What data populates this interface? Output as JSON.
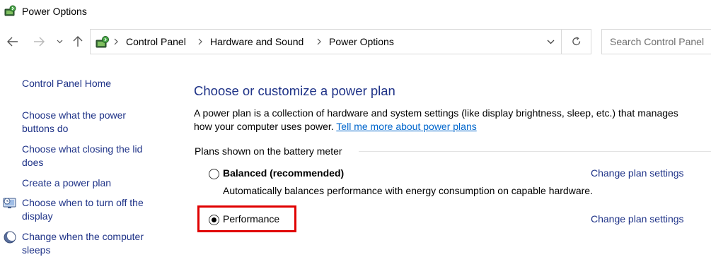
{
  "window": {
    "title": "Power Options",
    "icon": "power-options-icon"
  },
  "nav": {
    "back_icon": "back-arrow-icon",
    "forward_icon": "forward-arrow-icon",
    "recent_icon": "chevron-down-icon",
    "up_icon": "up-arrow-icon"
  },
  "address": {
    "breadcrumbs": [
      "Control Panel",
      "Hardware and Sound",
      "Power Options"
    ],
    "refresh_icon": "refresh-icon"
  },
  "search": {
    "placeholder": "Search Control Panel"
  },
  "sidebar": {
    "items": [
      {
        "label": "Control Panel Home"
      },
      {
        "label_line1": "Choose what the power",
        "label_line2": "buttons do"
      },
      {
        "label_line1": "Choose what closing the lid",
        "label_line2": "does"
      },
      {
        "label": "Create a power plan"
      },
      {
        "label_line1": "Choose when to turn off the",
        "label_line2": "display",
        "icon": "display-clock-icon"
      },
      {
        "label_line1": "Change when the computer",
        "label_line2": "sleeps",
        "icon": "moon-icon"
      }
    ]
  },
  "main": {
    "heading": "Choose or customize a power plan",
    "description_line1": "A power plan is a collection of hardware and system settings (like display brightness, sleep, etc.) that manages",
    "description_line2": "how your computer uses power.",
    "description_link": "Tell me more about power plans",
    "group_label": "Plans shown on the battery meter",
    "plans": [
      {
        "name": "Balanced (recommended)",
        "description": "Automatically balances performance with energy consumption on capable hardware.",
        "settings_link": "Change plan settings",
        "selected": false
      },
      {
        "name": "Performance",
        "settings_link": "Change plan settings",
        "selected": true
      }
    ]
  },
  "colors": {
    "link": "#1e3287",
    "hyperlink": "#0066cc",
    "highlight": "#e00000"
  }
}
